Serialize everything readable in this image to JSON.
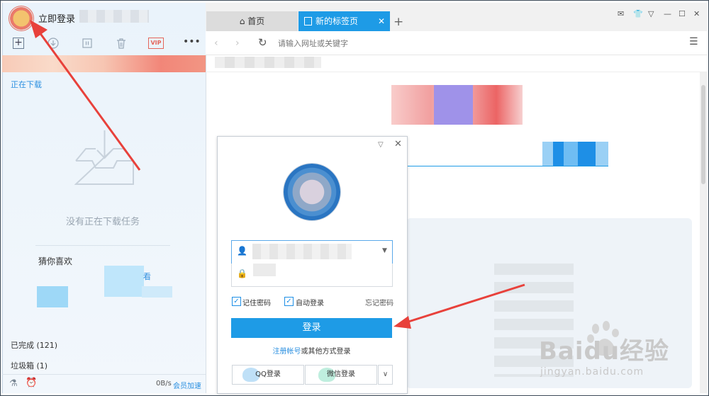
{
  "sidebar": {
    "login_label": "立即登录",
    "downloading_label": "正在下载",
    "empty_text": "没有正在下载任务",
    "guess_title": "猜你喜欢",
    "guess_link": "看",
    "done_label": "已完成 (121)",
    "trash_label": "垃圾箱 (1)",
    "speed": "0B/s",
    "vip_speed": "会员加速",
    "vip_badge": "VIP"
  },
  "tabs": [
    {
      "label": "首页"
    },
    {
      "label": "新的标签页"
    }
  ],
  "address": {
    "placeholder": "请输入网址或关键字"
  },
  "login_dialog": {
    "remember_label": "记住密码",
    "auto_login_label": "自动登录",
    "forgot_label": "忘记密码",
    "login_button": "登录",
    "register_link": "注册帐号",
    "register_suffix": "或其他方式登录",
    "qq_label": "QQ登录",
    "wechat_label": "微信登录"
  },
  "watermark": {
    "brand": "Baidu经验",
    "url": "jingyan.baidu.com"
  },
  "colors": {
    "accent": "#1e9be6",
    "annotation": "#e8413b"
  }
}
